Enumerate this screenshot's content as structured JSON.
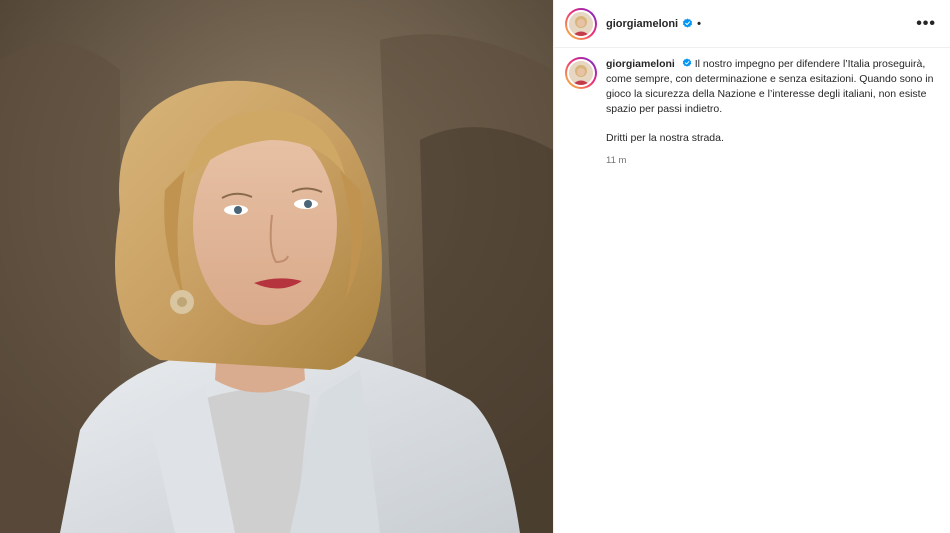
{
  "post": {
    "username": "giorgiameloni",
    "follow_dot": "•",
    "more_label": "•••",
    "caption_user": "giorgiameloni",
    "caption_text": "Il nostro impegno per difendere l’Italia proseguirà, come sempre, con determinazione e senza esitazioni. Quando sono in gioco la sicurezza della Nazione e l’interesse degli italiani, non esiste spazio per passi indietro.",
    "caption_text_2": "Dritti per la nostra strada.",
    "timestamp": "11 m"
  },
  "icons": {
    "verified": "verified-badge-icon",
    "more": "more-options-icon"
  },
  "colors": {
    "verified_blue": "#0095f6",
    "text": "#262626",
    "secondary_text": "#737373"
  }
}
